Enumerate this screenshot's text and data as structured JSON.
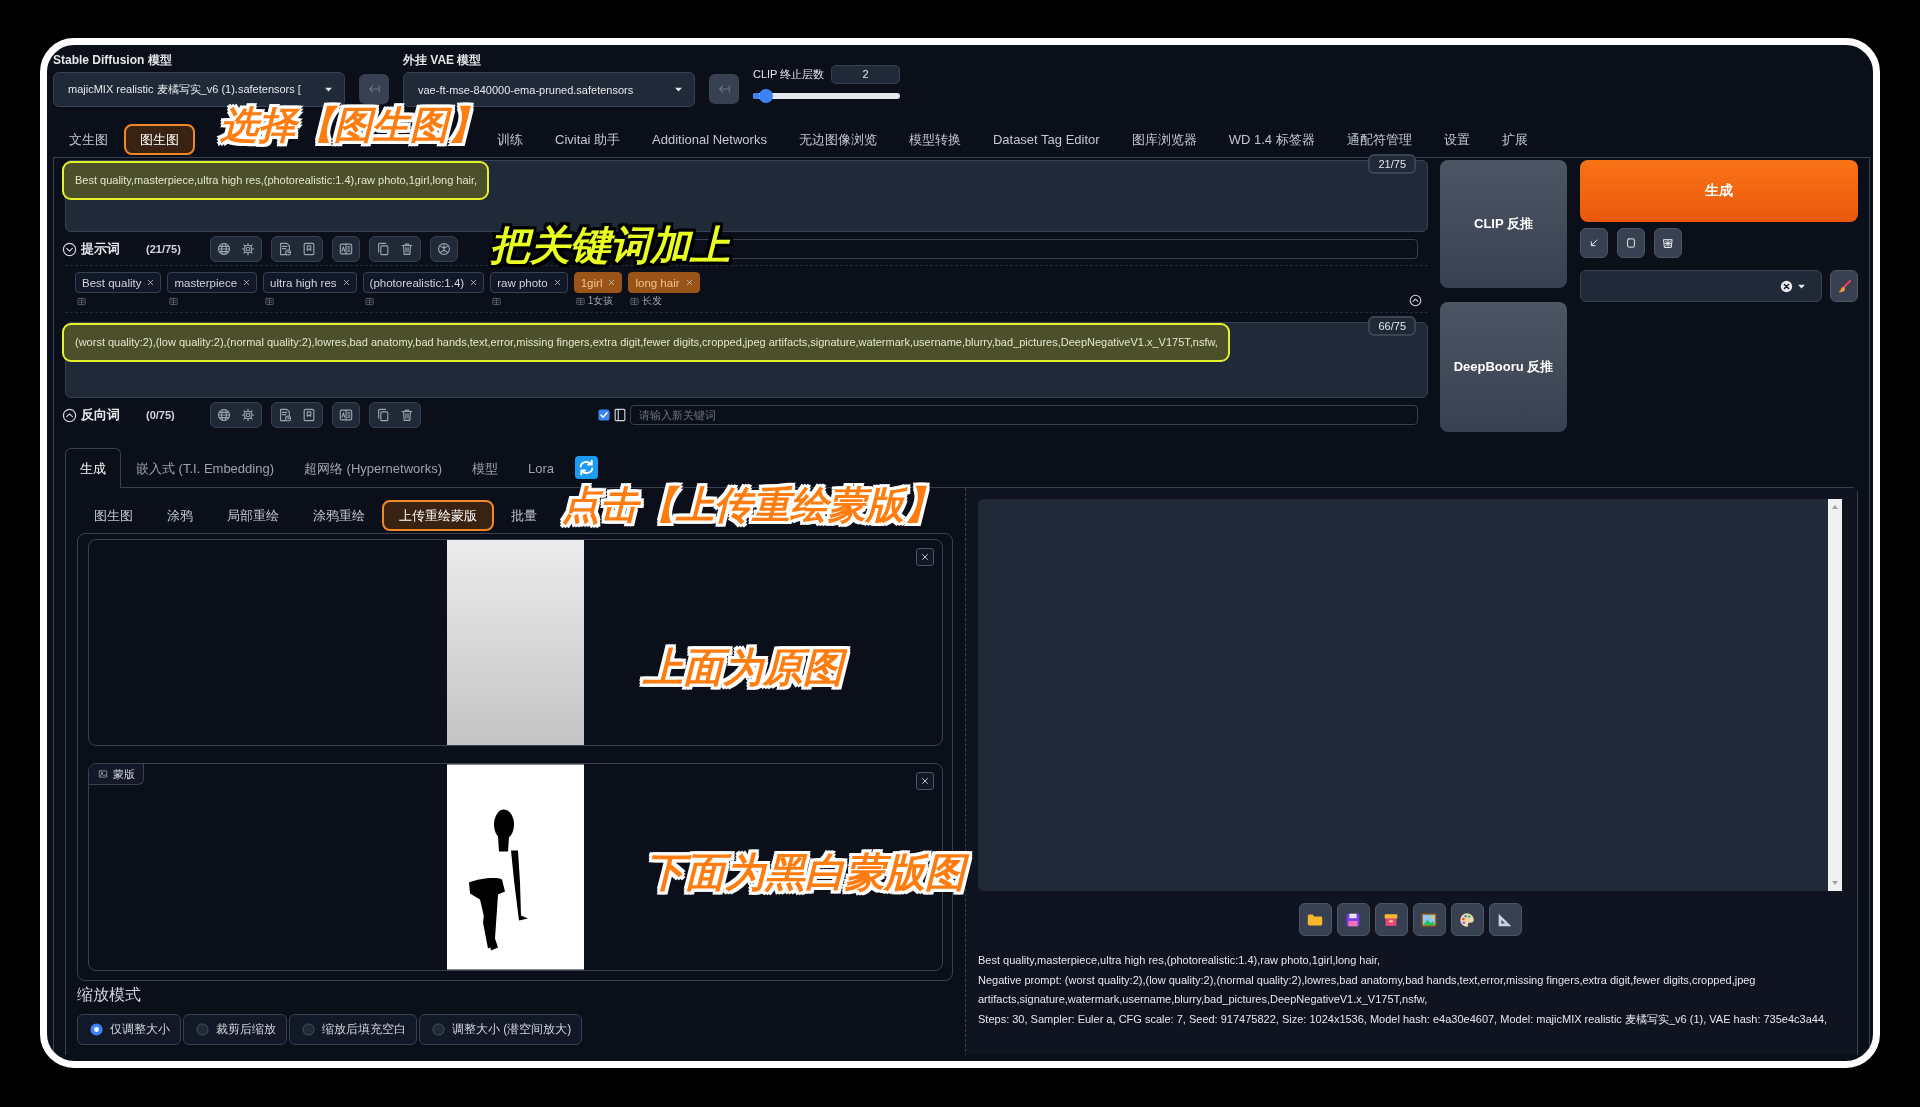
{
  "models": [
    {
      "label": "Stable Diffusion 模型",
      "value": "majicMIX realistic 麦橘写实_v6 (1).safetensors ["
    },
    {
      "label": "外挂 VAE 模型",
      "value": "vae-ft-mse-840000-ema-pruned.safetensors"
    }
  ],
  "clip_skip": {
    "label": "CLIP 终止层数",
    "value": "2",
    "level": 0.09
  },
  "main_tabs": [
    {
      "label": "文生图",
      "selected": false,
      "highlighted": false
    },
    {
      "label": "图生图",
      "selected": true,
      "highlighted": true
    },
    {
      "label": "训练",
      "selected": false,
      "highlighted": false
    },
    {
      "label": "Civitai 助手",
      "selected": false,
      "highlighted": false
    },
    {
      "label": "Additional Networks",
      "selected": false,
      "highlighted": false
    },
    {
      "label": "无边图像浏览",
      "selected": false,
      "highlighted": false
    },
    {
      "label": "模型转换",
      "selected": false,
      "highlighted": false
    },
    {
      "label": "Dataset Tag Editor",
      "selected": false,
      "highlighted": false
    },
    {
      "label": "图库浏览器",
      "selected": false,
      "highlighted": false
    },
    {
      "label": "WD 1.4 标签器",
      "selected": false,
      "highlighted": false
    },
    {
      "label": "通配符管理",
      "selected": false,
      "highlighted": false
    },
    {
      "label": "设置",
      "selected": false,
      "highlighted": false
    },
    {
      "label": "扩展",
      "selected": false,
      "highlighted": false
    }
  ],
  "prompt": {
    "text": "Best quality,masterpiece,ultra high res,(photorealistic:1.4),raw photo,1girl,long hair,",
    "highlighted": true,
    "counter": "21/75",
    "title": "提示词",
    "count": "(21/75)",
    "expanded": true
  },
  "tags": [
    {
      "label": "Best quality",
      "highlighted": false
    },
    {
      "label": "masterpiece",
      "highlighted": false
    },
    {
      "label": "ultra high res",
      "highlighted": false
    },
    {
      "label": "(photorealistic:1.4)",
      "highlighted": false
    },
    {
      "label": "raw photo",
      "highlighted": false
    },
    {
      "label": "1girl",
      "highlighted": true,
      "translation": "1女孩"
    },
    {
      "label": "long hair",
      "highlighted": true,
      "translation": "长发"
    }
  ],
  "negative_prompt": {
    "text": "(worst quality:2),(low quality:2),(normal quality:2),lowres,bad anatomy,bad hands,text,error,missing fingers,extra digit,fewer digits,cropped,jpeg artifacts,signature,watermark,username,blurry,bad_pictures,DeepNegativeV1.x_V175T,nsfw,",
    "highlighted": true,
    "counter": "66/75",
    "title": "反向词",
    "count": "(0/75)",
    "expanded": false,
    "checked": true,
    "placeholder": "请输入新关键词"
  },
  "interrogate_buttons": [
    {
      "label": "CLIP 反推"
    },
    {
      "label": "DeepBooru 反推"
    }
  ],
  "generate_button": {
    "label": "生成"
  },
  "gen_tabs": [
    {
      "label": "生成",
      "selected": true
    },
    {
      "label": "嵌入式 (T.I. Embedding)",
      "selected": false
    },
    {
      "label": "超网络 (Hypernetworks)",
      "selected": false
    },
    {
      "label": "模型",
      "selected": false
    },
    {
      "label": "Lora",
      "selected": false
    }
  ],
  "img2img_tabs": [
    {
      "label": "图生图",
      "selected": false,
      "highlighted": false
    },
    {
      "label": "涂鸦",
      "selected": false,
      "highlighted": false
    },
    {
      "label": "局部重绘",
      "selected": false,
      "highlighted": false
    },
    {
      "label": "涂鸦重绘",
      "selected": false,
      "highlighted": false
    },
    {
      "label": "上传重绘蒙版",
      "selected": true,
      "highlighted": true
    },
    {
      "label": "批量",
      "selected": false,
      "highlighted": false
    }
  ],
  "image_inputs": [
    {
      "kind": "photo"
    },
    {
      "kind": "mask",
      "label": "蒙版"
    }
  ],
  "resize_mode": {
    "label": "缩放模式",
    "options": [
      {
        "label": "仅调整大小",
        "selected": true
      },
      {
        "label": "裁剪后缩放",
        "selected": false
      },
      {
        "label": "缩放后填充空白",
        "selected": false
      },
      {
        "label": "调整大小 (潜空间放大)",
        "selected": false
      }
    ]
  },
  "generation_info": [
    "Best quality,masterpiece,ultra high res,(photorealistic:1.4),raw photo,1girl,long hair,",
    "Negative prompt: (worst quality:2),(low quality:2),(normal quality:2),lowres,bad anatomy,bad hands,text,error,missing fingers,extra digit,fewer digits,cropped,jpeg artifacts,signature,watermark,username,blurry,bad_pictures,DeepNegativeV1.x_V175T,nsfw,",
    "Steps: 30, Sampler: Euler a, CFG scale: 7, Seed: 917475822, Size: 1024x1536, Model hash: e4a30e4607, Model: majicMIX realistic 麦橘写实_v6 (1), VAE hash: 735e4c3a44,"
  ],
  "callouts": [
    {
      "text": "选择【图生图】",
      "kind": "orange"
    },
    {
      "text": "把关键词加上",
      "kind": "yellow"
    },
    {
      "text": "点击【上传重绘蒙版】",
      "kind": "orange"
    },
    {
      "text": "上面为原图",
      "kind": "orange"
    },
    {
      "text": "下面为黑白蒙版图",
      "kind": "orange"
    }
  ]
}
